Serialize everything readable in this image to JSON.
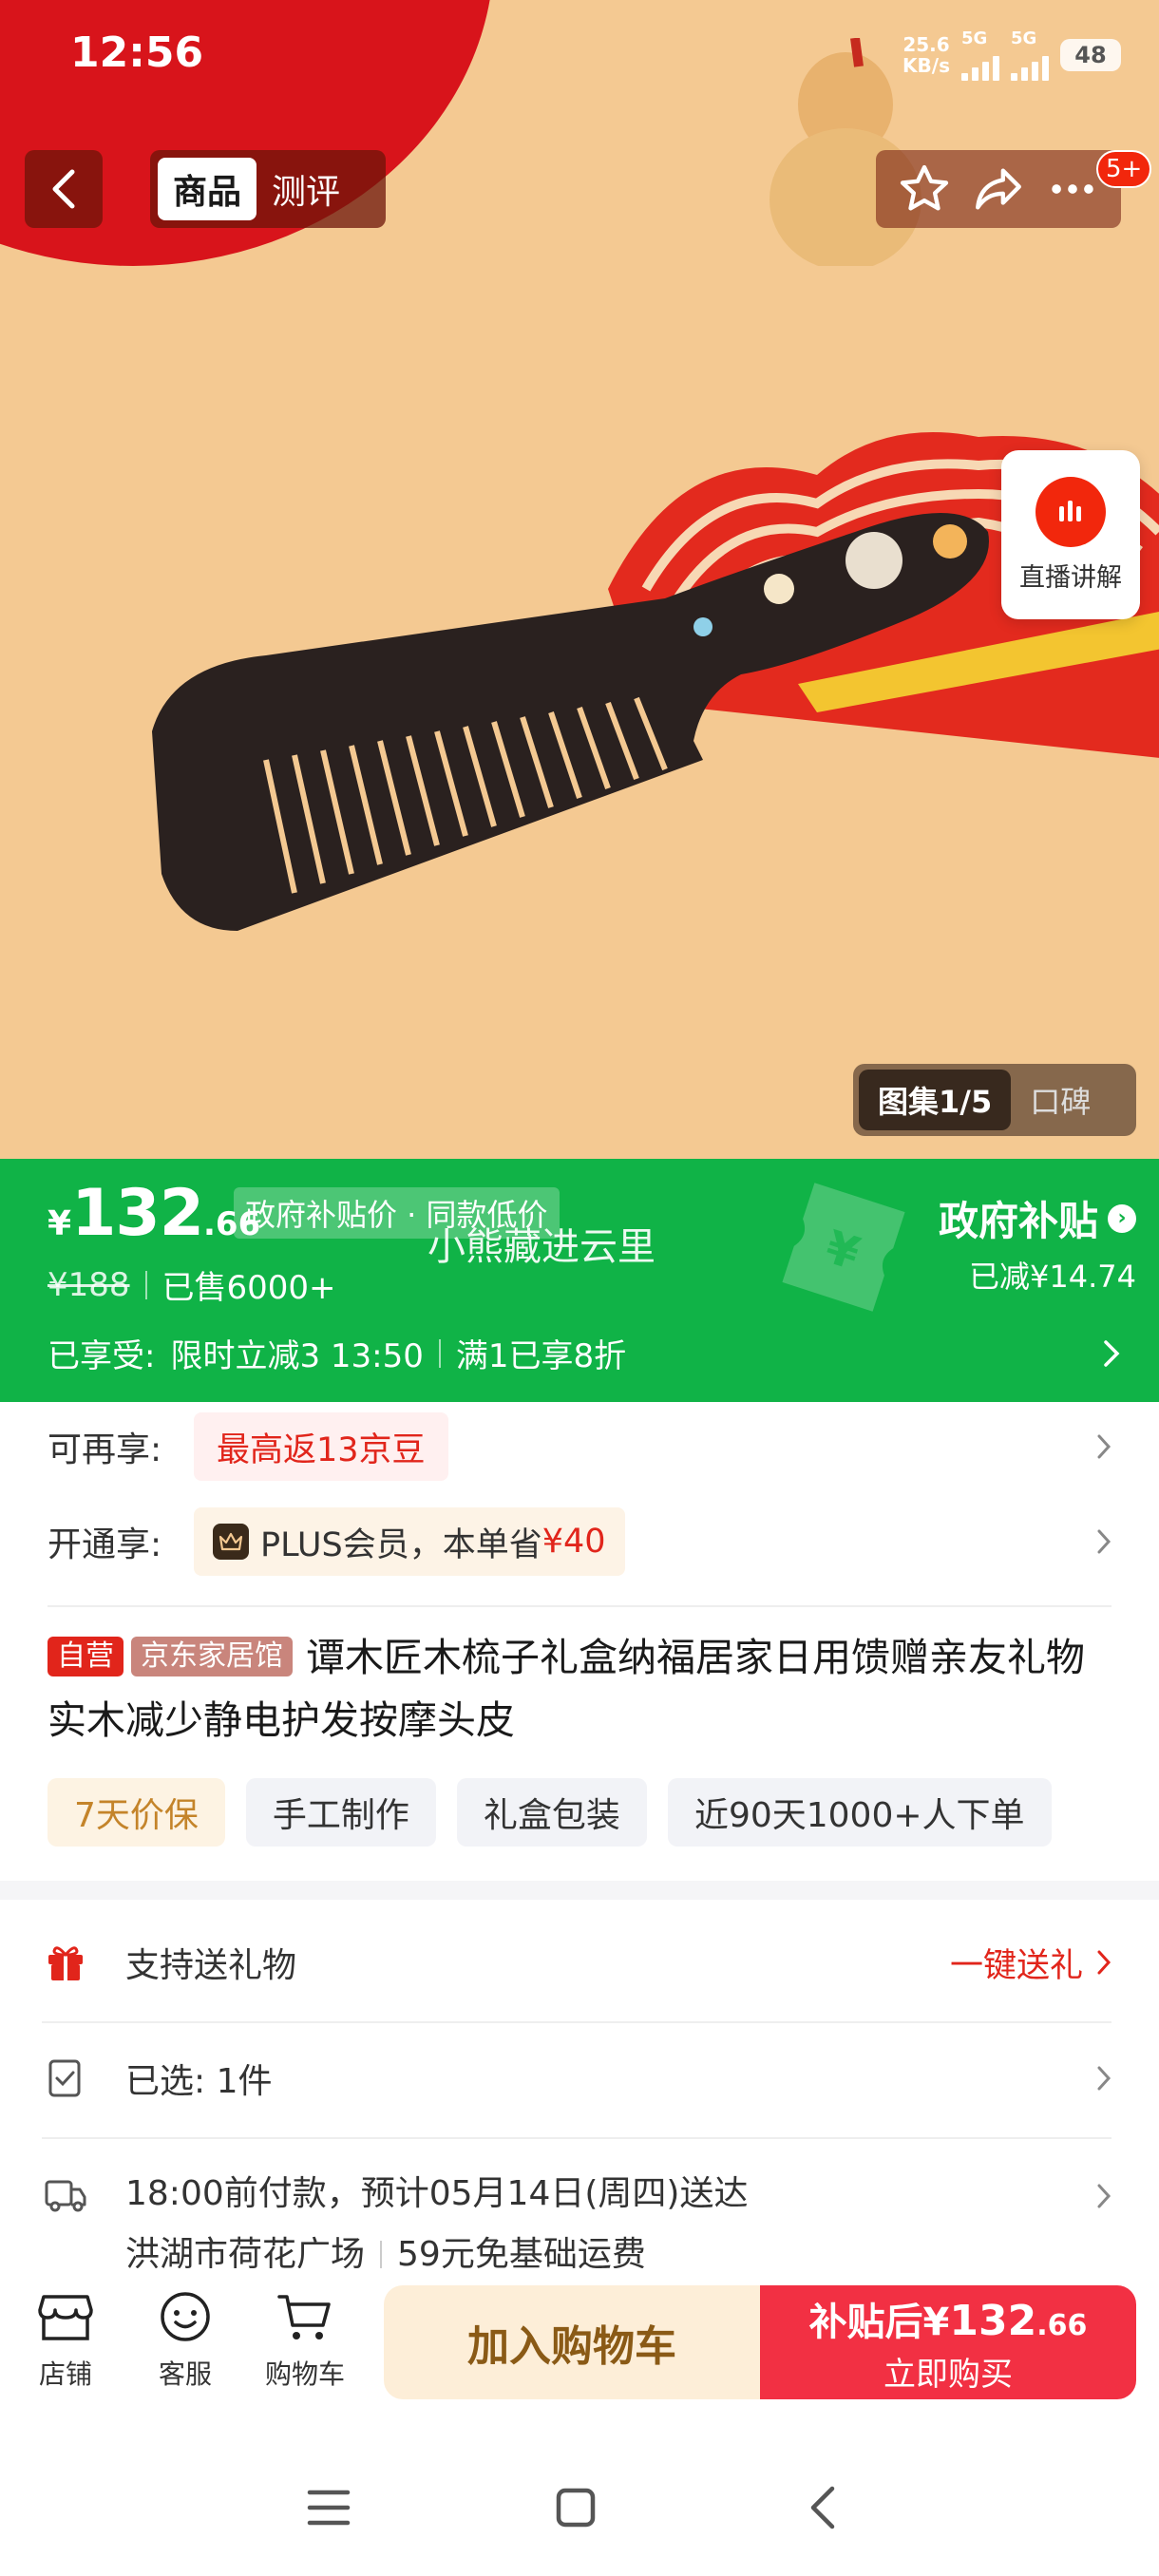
{
  "status_bar": {
    "time": "12:56",
    "net_speed_value": "25.6",
    "net_speed_unit": "KB/s",
    "network_1": "5G",
    "network_2": "5G",
    "battery": "48"
  },
  "header": {
    "tabs": [
      {
        "label": "商品",
        "active": true
      },
      {
        "label": "测评",
        "active": false
      }
    ],
    "badge": "5+"
  },
  "hero": {
    "live_label": "直播讲解",
    "gallery_tab": "图集1/5",
    "review_tab": "口碑"
  },
  "price_banner": {
    "currency": "¥",
    "price_int": "132",
    "price_dec": ".66",
    "gov_tag": "政府补贴价 · 同款低价",
    "watermark": "小熊藏进云里",
    "original_price": "¥188",
    "sold": "已售6000+",
    "enjoy_label": "已享受:",
    "enjoy_1": "限时立减3 13:50",
    "enjoy_2": "满1已享8折",
    "gov_title": "政府补贴",
    "gov_sub": "已减¥14.74",
    "colors": {
      "banner": "#10b347"
    }
  },
  "benefits": {
    "more_label": "可再享:",
    "more_value": "最高返13京豆",
    "open_label": "开通享:",
    "plus_text": "PLUS会员，本单省",
    "plus_amount": "¥40"
  },
  "product": {
    "tag_self": "自营",
    "tag_store": "京东家居馆",
    "title": "谭木匠木梳子礼盒纳福居家日用馈赠亲友礼物实木减少静电护发按摩头皮",
    "features": [
      "7天价保",
      "手工制作",
      "礼盒包装",
      "近90天1000+人下单"
    ]
  },
  "rows": {
    "gift_label": "支持送礼物",
    "gift_action": "一键送礼",
    "selected": "已选: 1件",
    "delivery_line1": "18:00前付款，预计05月14日(周四)送达",
    "delivery_addr": "洪湖市荷花广场",
    "delivery_fee": "59元免基础运费"
  },
  "bottom_bar": {
    "shop": "店铺",
    "service": "客服",
    "cart": "购物车",
    "add_cart": "加入购物车",
    "buy_prefix": "补贴后¥",
    "buy_int": "132",
    "buy_dec": ".66",
    "buy_sub": "立即购买",
    "colors": {
      "cart_bg": "#fdeed8",
      "buy_bg": "#f23043"
    }
  }
}
